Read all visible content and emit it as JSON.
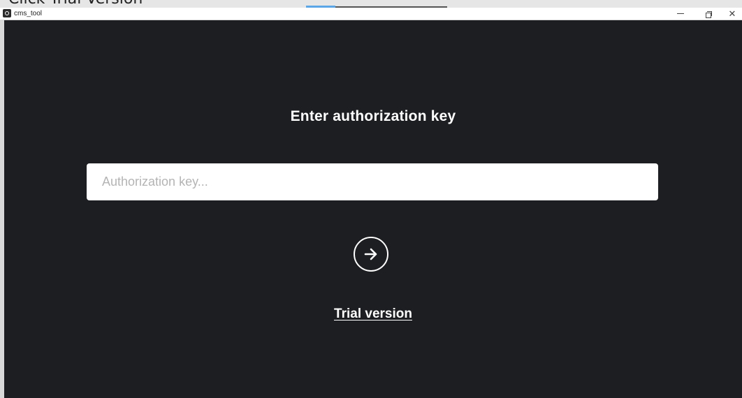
{
  "caption": {
    "text": "Click Trial Version"
  },
  "window": {
    "title": "cms_tool",
    "app_icon": "app-logo-icon",
    "controls": {
      "minimize_icon": "minimize-icon",
      "maximize_icon": "restore-icon",
      "close_icon": "close-icon",
      "close_glyph": "✕"
    }
  },
  "auth": {
    "heading": "Enter authorization key",
    "input_placeholder": "Authorization key...",
    "input_value": "",
    "submit_icon": "arrow-right-icon",
    "trial_link_label": "Trial version"
  },
  "colors": {
    "background": "#1c1e21",
    "text": "#ffffff",
    "input_bg": "#ffffff",
    "placeholder": "#b4b4b4"
  }
}
